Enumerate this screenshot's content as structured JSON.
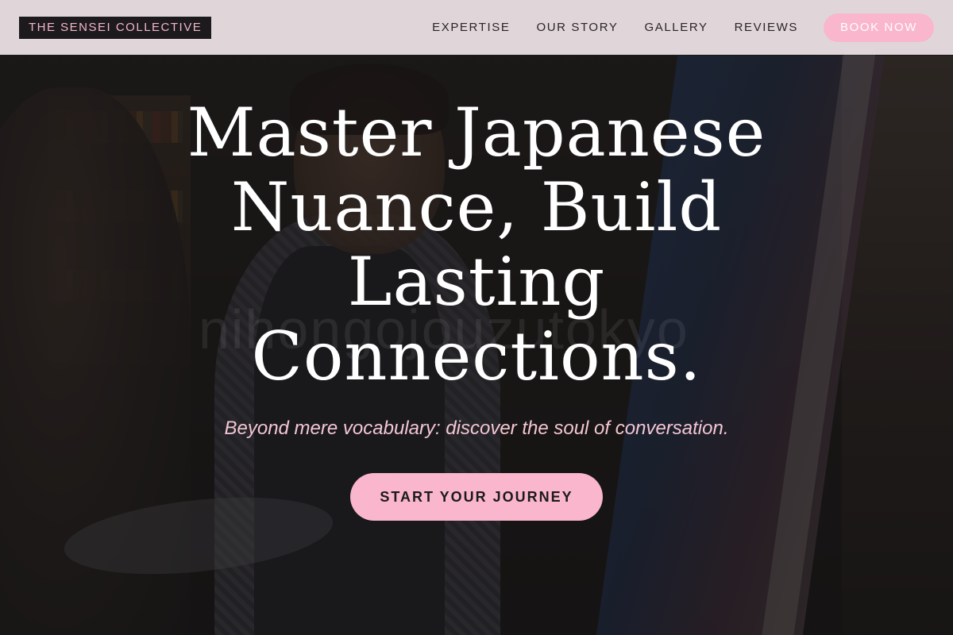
{
  "header": {
    "logo": "THE SENSEI COLLECTIVE",
    "nav": [
      "EXPERTISE",
      "OUR STORY",
      "GALLERY",
      "REVIEWS"
    ],
    "cta": "BOOK NOW"
  },
  "hero": {
    "headline": "Master Japanese Nuance, Build Lasting Connections.",
    "subheadline": "Beyond mere vocabulary: discover the soul of conversation.",
    "cta": "START YOUR JOURNEY",
    "watermark": "nihongojouzutokyo",
    "background_image": "person-painting-at-easel"
  },
  "colors": {
    "accent_pink": "#f9b6cc",
    "header_bg": "#e8dee2",
    "logo_bg": "#1c1a1c",
    "text_dark": "#2a2428"
  }
}
